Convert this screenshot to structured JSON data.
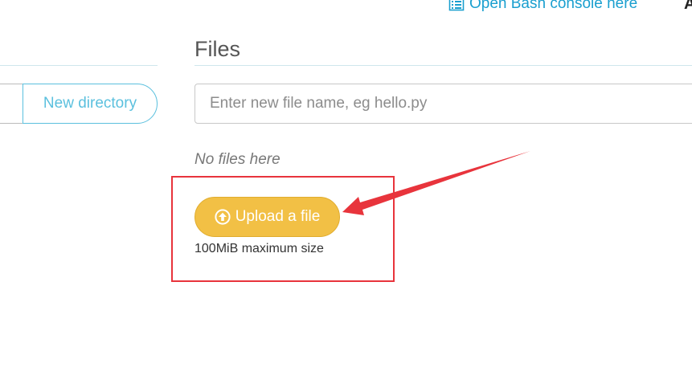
{
  "header": {
    "bash_link_label": "Open Bash console here",
    "bash_icon": "console-list-icon",
    "cut_off_text": "A"
  },
  "left_panel": {
    "new_directory_label": "New directory"
  },
  "files_panel": {
    "title": "Files",
    "new_file_placeholder": "Enter new file name, eg hello.py",
    "new_file_value": "",
    "empty_message": "No files here",
    "upload_label": "Upload a file",
    "upload_icon": "arrow-up-circle-icon",
    "max_size_note": "100MiB maximum size"
  },
  "colors": {
    "link": "#1a9fcf",
    "upload_button": "#f2c045",
    "annotation": "#e8343c",
    "outline_button": "#5bc0de"
  }
}
